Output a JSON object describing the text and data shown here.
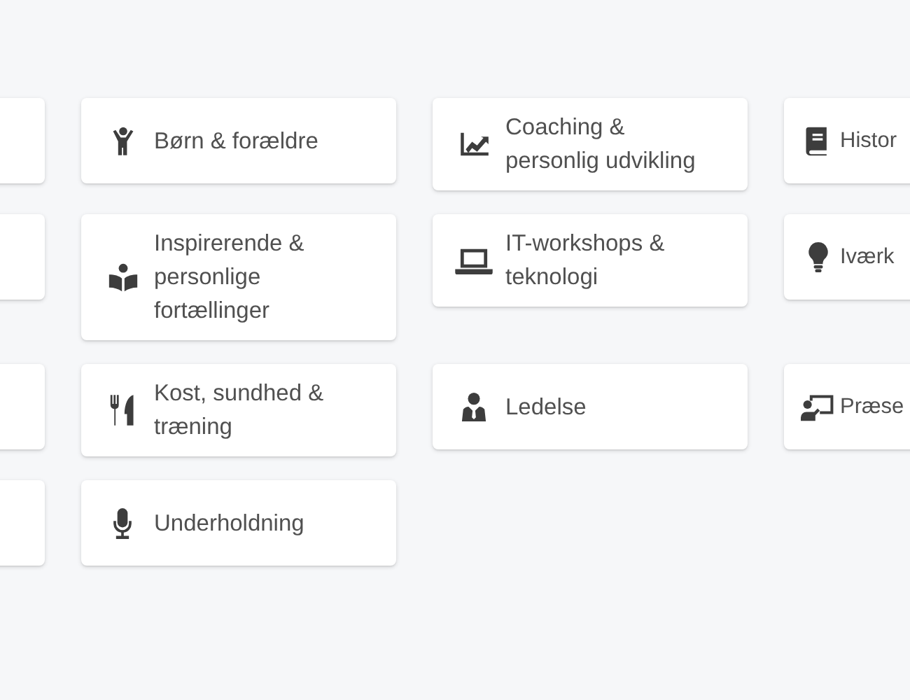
{
  "categories": [
    {
      "placeholder_card": true
    },
    {
      "label": "Børn & forældre"
    },
    {
      "label": "Coaching & personlig udvikling"
    },
    {
      "label": "Histor"
    },
    {
      "placeholder_card": true
    },
    {
      "label": "Inspirerende & personlige fortællinger"
    },
    {
      "label": "IT-workshops & teknologi"
    },
    {
      "label": "Iværk"
    },
    {
      "placeholder_card": true
    },
    {
      "label": "Kost, sundhed & træning"
    },
    {
      "label": "Ledelse"
    },
    {
      "label": "Præse"
    },
    {
      "placeholder_card": true
    },
    {
      "label": "Underholdning"
    }
  ]
}
